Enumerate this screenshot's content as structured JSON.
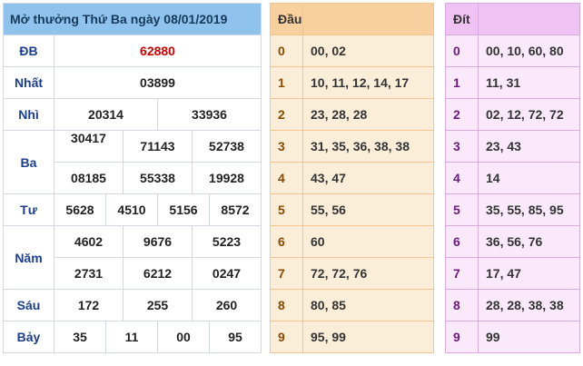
{
  "results": {
    "title": "Mở thưởng Thứ Ba ngày 08/01/2019",
    "labels": {
      "db": "ĐB",
      "nhat": "Nhất",
      "nhi": "Nhì",
      "ba": "Ba",
      "tu": "Tư",
      "nam": "Năm",
      "sau": "Sáu",
      "bay": "Bảy"
    },
    "db": "62880",
    "nhat": "03899",
    "nhi": [
      "20314",
      "33936"
    ],
    "ba": [
      "30417",
      "71143",
      "52738",
      "08185",
      "55338",
      "19928"
    ],
    "tu": [
      "5628",
      "4510",
      "5156",
      "8572"
    ],
    "nam": [
      "4602",
      "9676",
      "5223",
      "2731",
      "6212",
      "0247"
    ],
    "sau": [
      "172",
      "255",
      "260"
    ],
    "bay": [
      "35",
      "11",
      "00",
      "95"
    ]
  },
  "dau": {
    "header": "Đầu",
    "rows": [
      {
        "digit": "0",
        "values": "00, 02"
      },
      {
        "digit": "1",
        "values": "10, 11, 12, 14, 17"
      },
      {
        "digit": "2",
        "values": "23, 28, 28"
      },
      {
        "digit": "3",
        "values": "31, 35, 36, 38, 38"
      },
      {
        "digit": "4",
        "values": "43, 47"
      },
      {
        "digit": "5",
        "values": "55, 56"
      },
      {
        "digit": "6",
        "values": "60"
      },
      {
        "digit": "7",
        "values": "72, 72, 76"
      },
      {
        "digit": "8",
        "values": "80, 85"
      },
      {
        "digit": "9",
        "values": "95, 99"
      }
    ]
  },
  "dit": {
    "header": "Đít",
    "rows": [
      {
        "digit": "0",
        "values": "00, 10, 60, 80"
      },
      {
        "digit": "1",
        "values": "11, 31"
      },
      {
        "digit": "2",
        "values": "02, 12, 72, 72"
      },
      {
        "digit": "3",
        "values": "23, 43"
      },
      {
        "digit": "4",
        "values": "14"
      },
      {
        "digit": "5",
        "values": "35, 55, 85, 95"
      },
      {
        "digit": "6",
        "values": "36, 56, 76"
      },
      {
        "digit": "7",
        "values": "17, 47"
      },
      {
        "digit": "8",
        "values": "28, 28, 38, 38"
      },
      {
        "digit": "9",
        "values": "99"
      }
    ]
  },
  "colors": {
    "title_bg": "#8fc2ec",
    "special_prize": "#d10000",
    "label_text": "#1b3f8e",
    "dau_header_bg": "#f8cf9e",
    "dau_bg": "#fbeed9",
    "dit_header_bg": "#f0c2f4",
    "dit_bg": "#f9e9fb"
  }
}
